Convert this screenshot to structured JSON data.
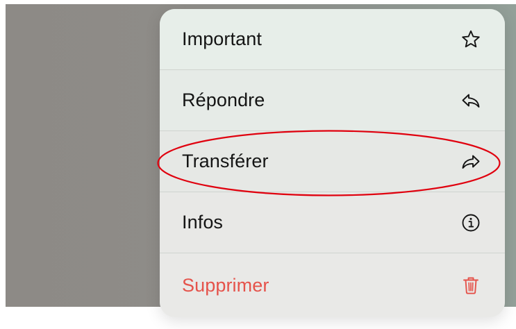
{
  "context_menu": {
    "items": [
      {
        "label": "Important",
        "icon": "star-icon"
      },
      {
        "label": "Répondre",
        "icon": "reply-icon"
      },
      {
        "label": "Transférer",
        "icon": "forward-icon"
      },
      {
        "label": "Infos",
        "icon": "info-icon"
      },
      {
        "label": "Supprimer",
        "icon": "trash-icon",
        "destructive": true
      }
    ]
  },
  "colors": {
    "menu_background": "#e8ece8",
    "text": "#141414",
    "destructive": "#e5534b",
    "annotation": "#e0000e",
    "backdrop": "#8e8c88"
  }
}
